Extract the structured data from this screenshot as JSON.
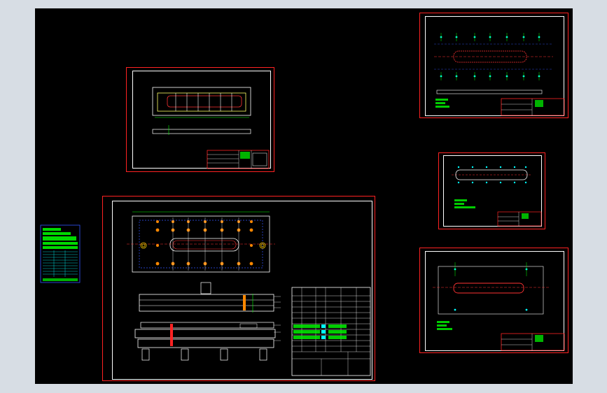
{
  "canvas": {
    "background": "#000000",
    "frame": "#d7dde4"
  },
  "colors": {
    "border": "#ff2222",
    "line": "#ffffff",
    "accent": "#00ff00",
    "part": "#ffd000",
    "hole": "#ff8800",
    "center": "#3355ff",
    "cyan": "#00ffff"
  },
  "sheets": [
    {
      "id": "top-left-view"
    },
    {
      "id": "main-assembly"
    },
    {
      "id": "right-top-plate"
    },
    {
      "id": "right-mid-plate"
    },
    {
      "id": "right-bottom-plate"
    },
    {
      "id": "left-bom"
    }
  ],
  "main": {
    "title_block": {
      "bottom_left": "",
      "bottom_main": ""
    }
  }
}
